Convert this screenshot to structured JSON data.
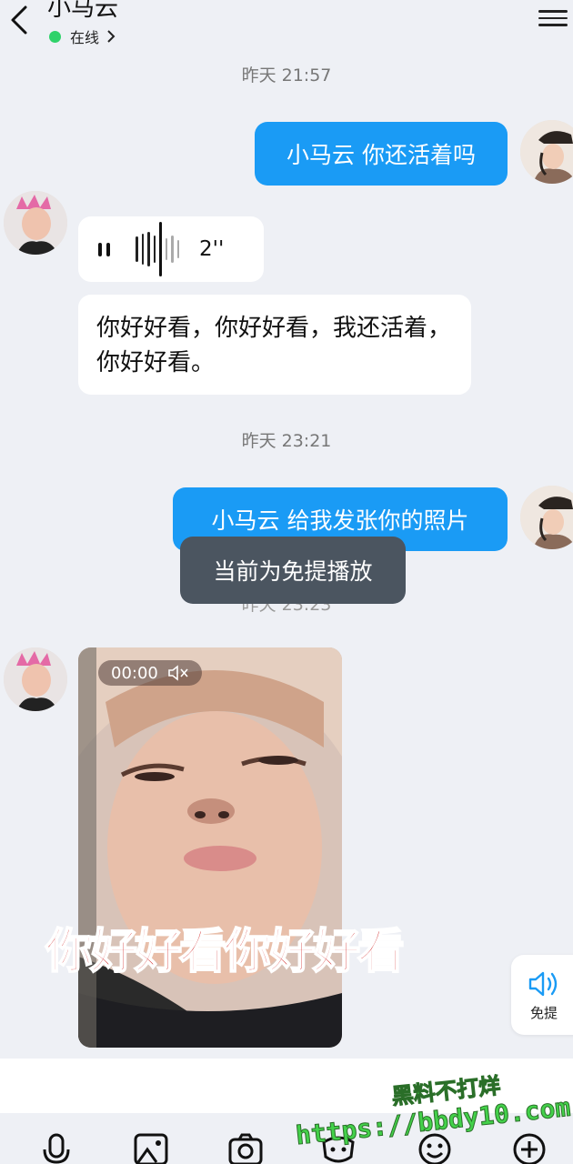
{
  "header": {
    "title": "小马云",
    "status": "在线"
  },
  "messages": {
    "time1": "昨天 21:57",
    "me1": "小马云 你还活着吗",
    "voice_duration": "2''",
    "transcript": "你好好看，你好好看，我还活着，你好好看。",
    "time2": "昨天 23:21",
    "me2": "小马云 给我发张你的照片",
    "time3_partial": "昨天 23:23"
  },
  "toast": "当前为免提播放",
  "video": {
    "time": "00:00",
    "caption": "你好好看你好好看",
    "muted": true
  },
  "speaker_button": {
    "label": "免提",
    "icon": "speaker-icon"
  },
  "toolbar": {
    "icons": [
      "microphone-icon",
      "image-icon",
      "camera-icon",
      "emoji-gift-icon",
      "smile-icon",
      "plus-icon"
    ]
  },
  "watermark": {
    "line1": "黑料不打烊",
    "line2": "https://bbdy10.com"
  },
  "colors": {
    "accent": "#1a9bf5",
    "online": "#2fd26a",
    "background": "#eef0f5"
  }
}
